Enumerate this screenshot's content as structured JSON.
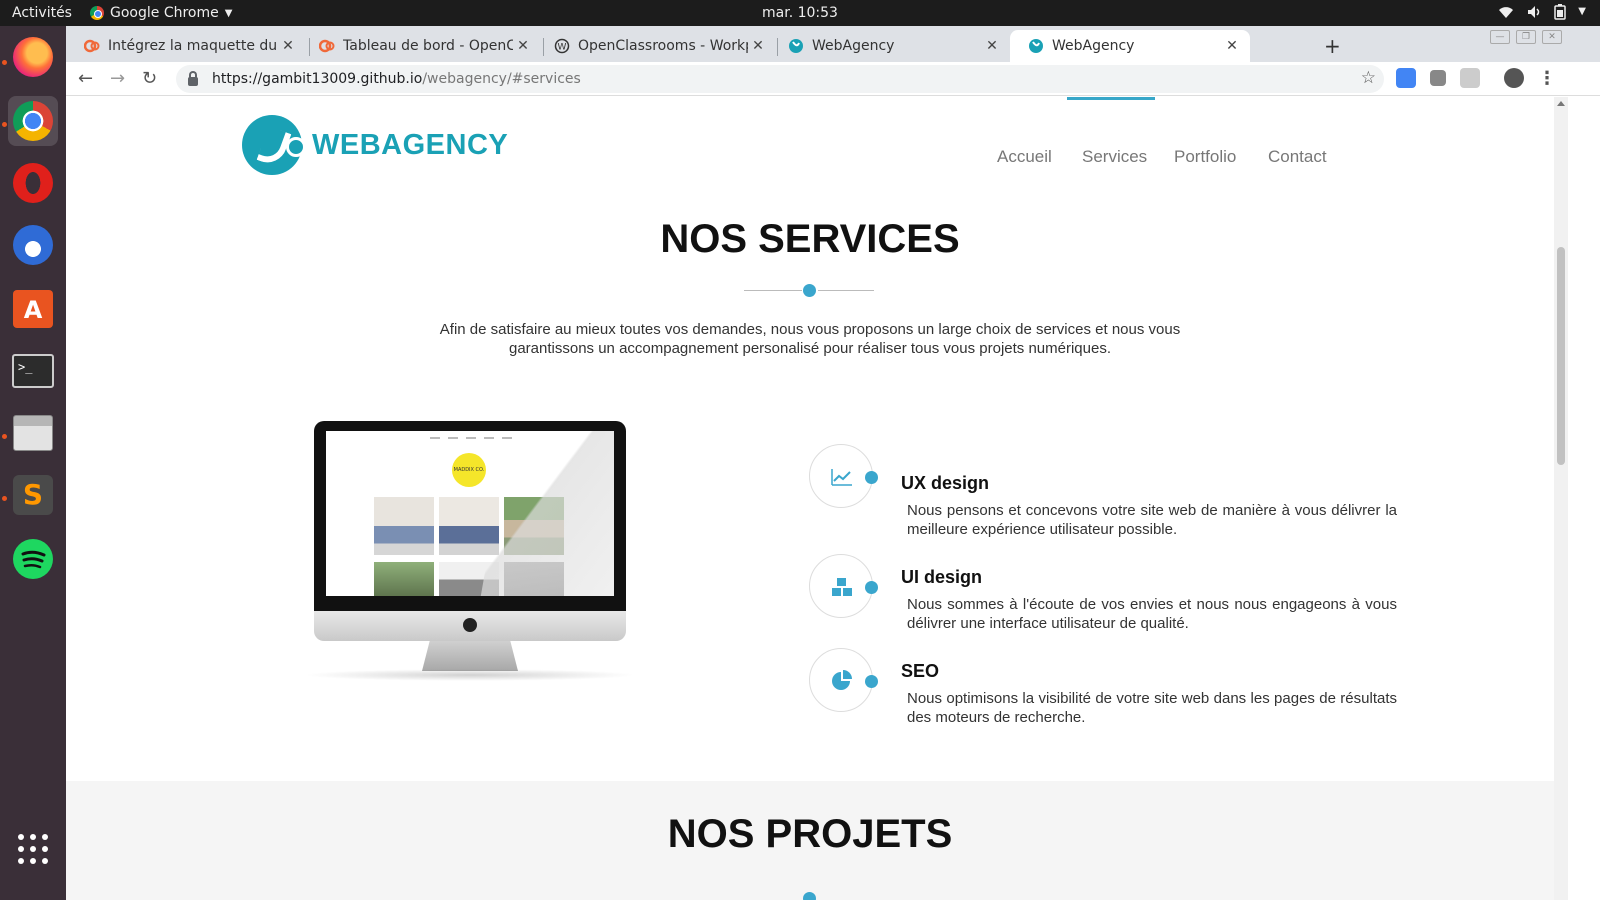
{
  "os": {
    "activities": "Activités",
    "app_name": "Google Chrome",
    "clock": "mar. 10:53",
    "tray_icons": [
      "wifi-icon",
      "volume-icon",
      "battery-icon",
      "chevron-down-icon"
    ],
    "dock": [
      "firefox",
      "chrome",
      "opera",
      "thunderbird",
      "ubuntu-software",
      "terminal",
      "files",
      "sublime-text",
      "spotify",
      "show-applications"
    ]
  },
  "browser": {
    "tabs": [
      {
        "label": "Intégrez la maquette du s",
        "favicon": "openclassrooms"
      },
      {
        "label": "Tableau de bord - OpenCla",
        "favicon": "openclassrooms"
      },
      {
        "label": "OpenClassrooms - Workp",
        "favicon": "wordpress"
      },
      {
        "label": "WebAgency",
        "favicon": "webagency"
      },
      {
        "label": "WebAgency",
        "favicon": "webagency"
      }
    ],
    "active_tab": 4,
    "url_host": "https://gambit13009.github.io",
    "url_path": "/webagency/#services"
  },
  "site": {
    "logo_text": "WEBAGENCY",
    "nav": [
      "Accueil",
      "Services",
      "Portfolio",
      "Contact"
    ],
    "active_nav": "Services",
    "accent": "#3aa6cd",
    "brand": "#1aa1b5",
    "services_title": "NOS SERVICES",
    "services_intro": "Afin de satisfaire au mieux toutes vos demandes, nous vous proposons un large choix de services et nous vous garantissons un accompagnement personalisé pour réaliser tous vous projets numériques.",
    "mockup_logo": "MADDIX CO.",
    "services": [
      {
        "title": "UX design",
        "icon": "line-chart-icon",
        "text": "Nous pensons et concevons votre site web de manière à vous délivrer la meilleure expérience utilisateur possible."
      },
      {
        "title": "UI design",
        "icon": "cubes-icon",
        "text": "Nous sommes à l'écoute de vos envies et nous nous engageons à vous délivrer une interface utilisateur de qualité."
      },
      {
        "title": "SEO",
        "icon": "pie-chart-icon",
        "text": "Nous optimisons la visibilité de votre site web dans les pages de résultats des moteurs de recherche."
      }
    ],
    "projects_title": "NOS PROJETS"
  }
}
